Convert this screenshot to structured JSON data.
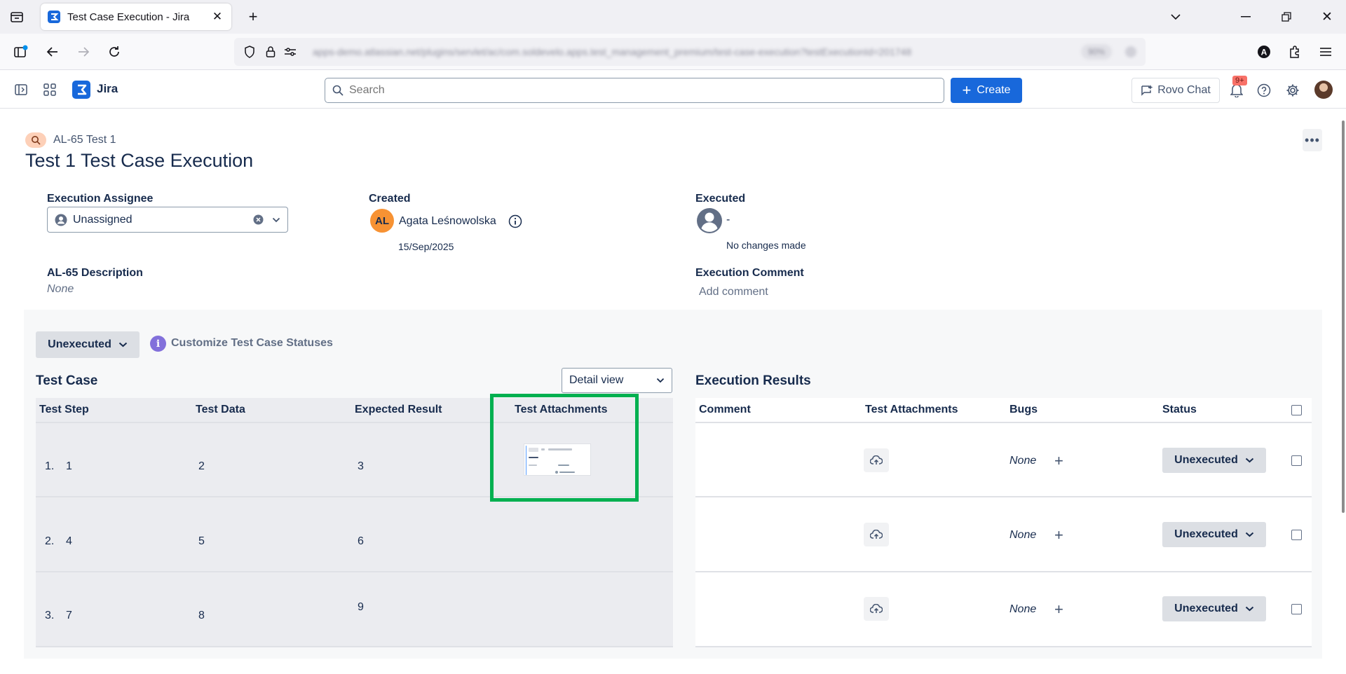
{
  "browser": {
    "tab_title": "Test Case Execution - Jira",
    "url": "apps-demo.atlassian.net/plugins/servlet/ac/com.soldevelo.apps.test_management_premium/test-case-execution?testExecutionId=201748",
    "zoom": "90%"
  },
  "jira_nav": {
    "product": "Jira",
    "search_placeholder": "Search",
    "create_label": "Create",
    "rovo_label": "Rovo Chat",
    "notification_badge": "9+"
  },
  "header": {
    "breadcrumb": "AL-65 Test 1",
    "title": "Test 1 Test Case Execution"
  },
  "details": {
    "assignee_label": "Execution Assignee",
    "assignee_value": "Unassigned",
    "created_label": "Created",
    "created_avatar": "AL",
    "created_by": "Agata Leśnowolska",
    "created_date": "15/Sep/2025",
    "executed_label": "Executed",
    "executed_value": "-",
    "executed_note": "No changes made",
    "description_label": "AL-65 Description",
    "description_value": "None",
    "comment_label": "Execution Comment",
    "comment_placeholder": "Add comment"
  },
  "panel": {
    "status": "Unexecuted",
    "customize_link": "Customize Test Case Statuses",
    "test_case_title": "Test Case",
    "view_mode": "Detail view",
    "results_title": "Execution Results"
  },
  "test_case_table": {
    "headers": [
      "Test Step",
      "Test Data",
      "Expected Result",
      "Test Attachments"
    ],
    "rows": [
      {
        "num": "1.",
        "step": "1",
        "data": "2",
        "expected": "3",
        "has_attachment": true
      },
      {
        "num": "2.",
        "step": "4",
        "data": "5",
        "expected": "6",
        "has_attachment": false
      },
      {
        "num": "3.",
        "step": "7",
        "data": "8",
        "expected": "9",
        "has_attachment": false
      }
    ]
  },
  "results_table": {
    "headers": [
      "Comment",
      "Test Attachments",
      "Bugs",
      "Status"
    ],
    "rows": [
      {
        "bugs": "None",
        "status": "Unexecuted"
      },
      {
        "bugs": "None",
        "status": "Unexecuted"
      },
      {
        "bugs": "None",
        "status": "Unexecuted"
      }
    ]
  },
  "colors": {
    "brand_blue": "#1868db",
    "highlight_green": "#00b050",
    "avatar_orange": "#f79233",
    "info_purple": "#8270db"
  }
}
